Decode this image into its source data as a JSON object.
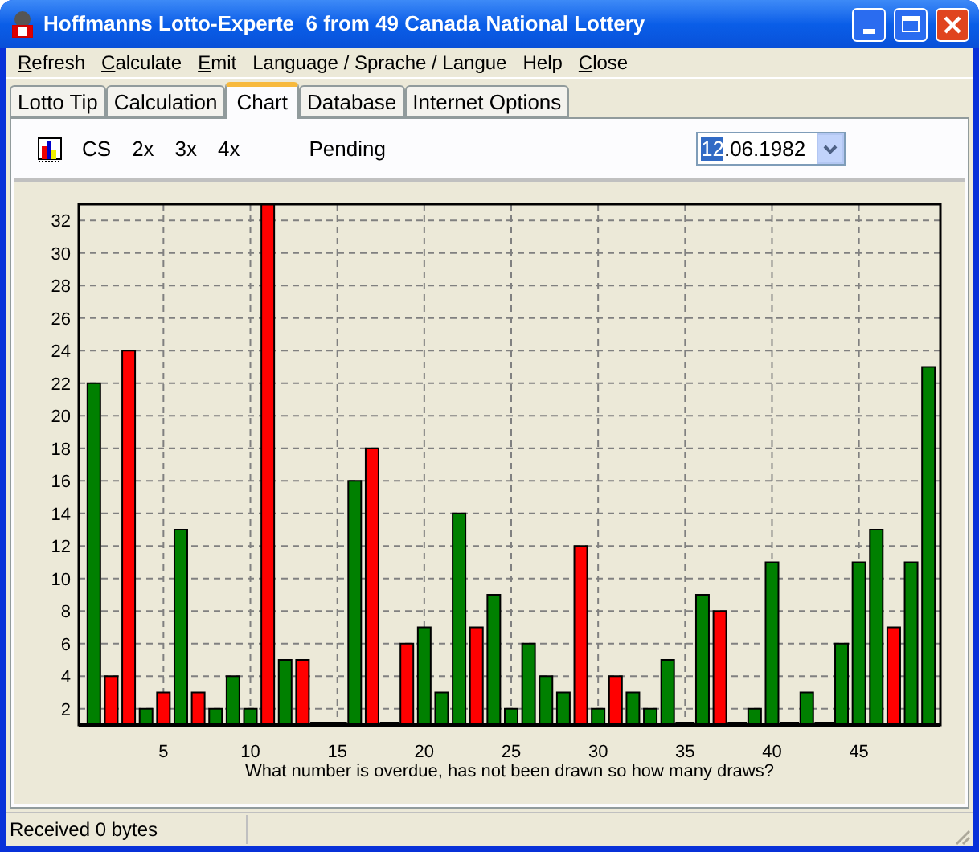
{
  "window": {
    "title": "Hoffmanns Lotto-Experte  6 from 49 Canada National Lottery"
  },
  "menu": [
    {
      "label": "Refresh",
      "accel": true
    },
    {
      "label": "Calculate",
      "accel": true
    },
    {
      "label": "Emit",
      "accel": true
    },
    {
      "label": "Language / Sprache / Langue",
      "accel": false
    },
    {
      "label": "Help",
      "accel": false
    },
    {
      "label": "Close",
      "accel": true
    }
  ],
  "tabs": [
    {
      "label": "Lotto Tip",
      "selected": false
    },
    {
      "label": "Calculation",
      "selected": false
    },
    {
      "label": "Chart",
      "selected": true
    },
    {
      "label": "Database",
      "selected": false
    },
    {
      "label": "Internet Options",
      "selected": false
    }
  ],
  "toolbar": {
    "items": [
      "CS",
      "2x",
      "3x",
      "4x"
    ],
    "status": "Pending"
  },
  "date_field": {
    "segments": [
      {
        "text": "12",
        "selected": true
      },
      {
        "text": ".06.1982",
        "selected": false
      }
    ]
  },
  "chart": {
    "chart_data": {
      "type": "bar",
      "xlabel": "What number is overdue, has not been drawn so how many draws?",
      "x": [
        1,
        2,
        3,
        4,
        5,
        6,
        7,
        8,
        9,
        10,
        11,
        12,
        13,
        14,
        15,
        16,
        17,
        18,
        19,
        20,
        21,
        22,
        23,
        24,
        25,
        26,
        27,
        28,
        29,
        30,
        31,
        32,
        33,
        34,
        35,
        36,
        37,
        38,
        39,
        40,
        41,
        42,
        43,
        44,
        45,
        46,
        47,
        48,
        49
      ],
      "grid": true,
      "xlim": [
        0.5,
        49.5
      ],
      "ylim": [
        1,
        33
      ],
      "xticks": [
        5,
        10,
        15,
        20,
        25,
        30,
        35,
        40,
        45
      ],
      "yticks": [
        2,
        4,
        6,
        8,
        10,
        12,
        14,
        16,
        18,
        20,
        22,
        24,
        26,
        28,
        30,
        32
      ],
      "series": [
        {
          "color": "#008000",
          "values": [
            22,
            null,
            null,
            2,
            null,
            13,
            null,
            2,
            4,
            2,
            null,
            5,
            null,
            null,
            null,
            16,
            null,
            null,
            null,
            7,
            3,
            14,
            null,
            9,
            2,
            6,
            4,
            3,
            null,
            2,
            null,
            3,
            2,
            5,
            null,
            9,
            null,
            null,
            2,
            11,
            null,
            3,
            null,
            6,
            11,
            13,
            null,
            11,
            23
          ]
        },
        {
          "color": "#ff0000",
          "values": [
            null,
            4,
            24,
            null,
            3,
            null,
            3,
            null,
            null,
            null,
            33,
            null,
            5,
            null,
            null,
            null,
            18,
            null,
            6,
            null,
            null,
            null,
            7,
            null,
            null,
            null,
            null,
            null,
            12,
            null,
            4,
            null,
            null,
            null,
            null,
            null,
            8,
            null,
            null,
            null,
            null,
            null,
            null,
            null,
            null,
            null,
            7,
            null,
            null
          ]
        }
      ]
    }
  },
  "status_bar": {
    "text": "Received 0 bytes"
  }
}
